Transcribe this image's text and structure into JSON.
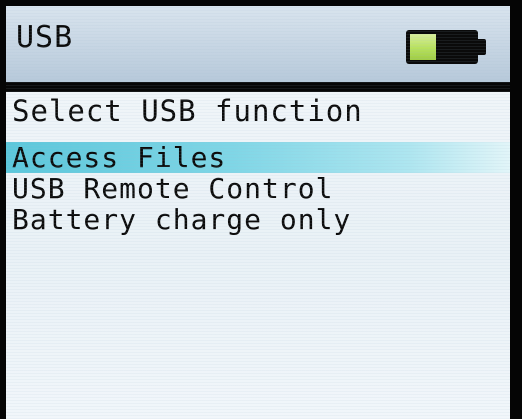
{
  "title_bar": {
    "title": "USB",
    "battery": {
      "icon": "battery-icon",
      "level": 0.4,
      "fill_color": "#b7e15d"
    }
  },
  "heading": "Select USB function",
  "menu": {
    "items": [
      {
        "label": "Access Files",
        "selected": true
      },
      {
        "label": "USB Remote Control",
        "selected": false
      },
      {
        "label": "Battery charge only",
        "selected": false
      }
    ],
    "highlight_color": "#5bc7db"
  }
}
